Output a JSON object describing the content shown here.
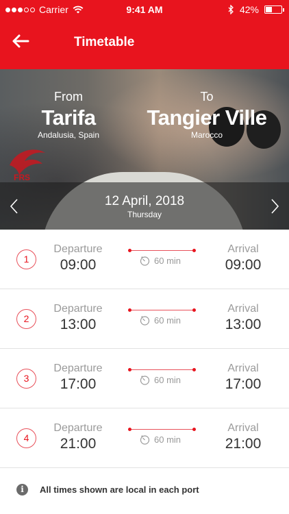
{
  "status_bar": {
    "carrier": "Carrier",
    "time": "9:41 AM",
    "battery_text": "42%",
    "battery_level": 0.42,
    "signal_bars_filled": 3,
    "signal_bars_total": 5
  },
  "header": {
    "title": "Timetable",
    "back_icon": "arrow-left-icon"
  },
  "route": {
    "from_label": "From",
    "from_city": "Tarifa",
    "from_region": "Andalusia, Spain",
    "to_label": "To",
    "to_city": "Tangier Ville",
    "to_region": "Marocco"
  },
  "date": {
    "main": "12 April, 2018",
    "weekday": "Thursday",
    "prev_icon": "chevron-left-icon",
    "next_icon": "chevron-right-icon"
  },
  "trips": [
    {
      "num": "1",
      "departure_label": "Departure",
      "departure": "09:00",
      "duration": "60 min",
      "arrival_label": "Arrival",
      "arrival": "09:00"
    },
    {
      "num": "2",
      "departure_label": "Departure",
      "departure": "13:00",
      "duration": "60 min",
      "arrival_label": "Arrival",
      "arrival": "13:00"
    },
    {
      "num": "3",
      "departure_label": "Departure",
      "departure": "17:00",
      "duration": "60 min",
      "arrival_label": "Arrival",
      "arrival": "17:00"
    },
    {
      "num": "4",
      "departure_label": "Departure",
      "departure": "21:00",
      "duration": "60 min",
      "arrival_label": "Arrival",
      "arrival": "21:00"
    }
  ],
  "footer_note": {
    "icon": "info-icon",
    "icon_glyph": "i",
    "text": "All times shown are local in each port"
  },
  "colors": {
    "brand_red": "#e8141e",
    "muted_text": "#9a9a9a"
  }
}
